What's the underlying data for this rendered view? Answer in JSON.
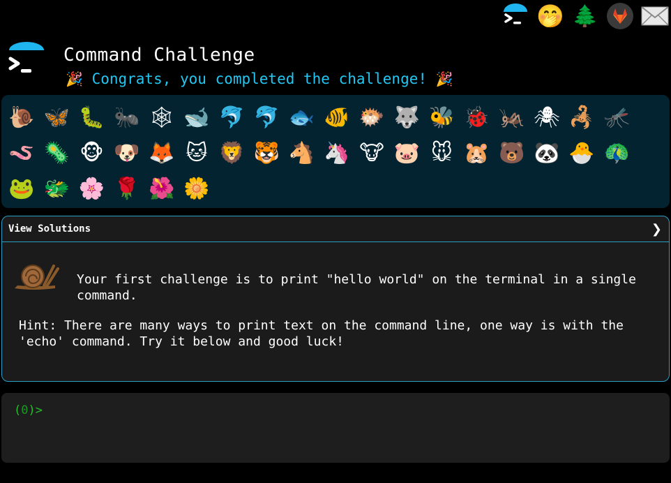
{
  "top_icons": [
    {
      "name": "terminal-logo-icon"
    },
    {
      "name": "shushing-face-icon",
      "glyph": "🤭"
    },
    {
      "name": "tree-icon",
      "glyph": "🌲"
    },
    {
      "name": "gitlab-icon"
    },
    {
      "name": "mail-icon",
      "glyph": "✉"
    }
  ],
  "header": {
    "title": "Command Challenge",
    "congrats_text": "Congrats, you completed the challenge!",
    "party_icon": "🎉"
  },
  "emojis": [
    "🐌",
    "🦋",
    "🐛",
    "🐜",
    "🕸",
    "🐋",
    "🐬",
    "🐬",
    "🐟",
    "🐠",
    "🐡",
    "🐺",
    "🐝",
    "🐞",
    "🦗",
    "🕷",
    "🦂",
    "🦟",
    "🪱",
    "🦠",
    "🐵",
    "🐶",
    "🦊",
    "🐱",
    "🦁",
    "🐯",
    "🐴",
    "🦄",
    "🐮",
    "🐷",
    "🐭",
    "🐹",
    "🐻",
    "🐼",
    "🐣",
    "🦚",
    "🐸",
    "🐲",
    "🌸",
    "🌹",
    "🌺",
    "🌼"
  ],
  "solutions": {
    "header_label": "View Solutions",
    "chevron": "❯",
    "challenge_text": "Your first challenge is to print \"hello world\" on the terminal in a single command.",
    "hint_text": "Hint: There are many ways to print text on the command line, one way is with the 'echo' command. Try it below and good luck!"
  },
  "terminal": {
    "prompt_open": "(",
    "prompt_number": "0",
    "prompt_close": ")>"
  },
  "colors": {
    "accent": "#22c7f3",
    "panel_bg": "#032331",
    "card_border": "#2aa0c7",
    "prompt_green": "#22c12a"
  }
}
